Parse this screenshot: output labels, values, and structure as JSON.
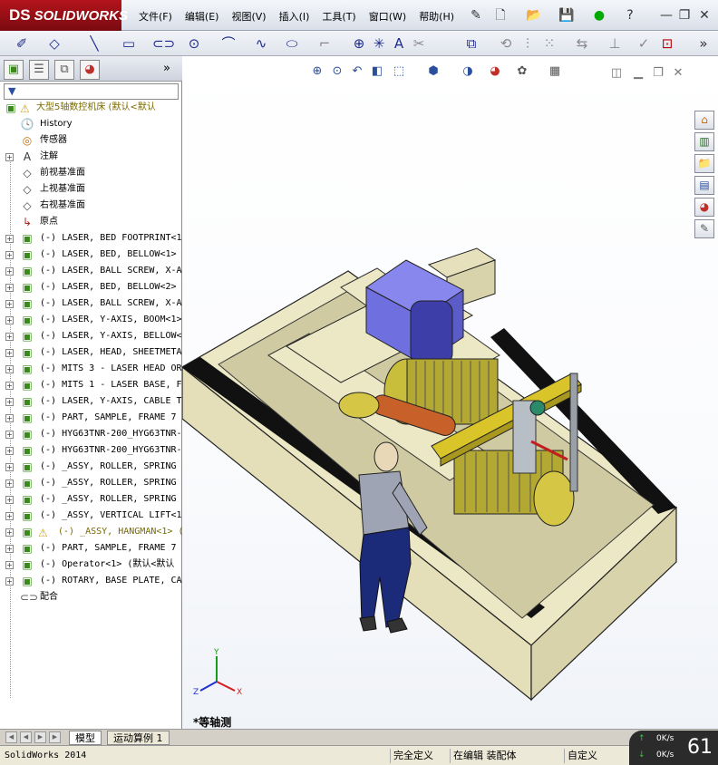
{
  "app": {
    "brand": "SOLIDWORKS",
    "brand_prefix": "DS"
  },
  "menus": [
    "文件(F)",
    "编辑(E)",
    "视图(V)",
    "插入(I)",
    "工具(T)",
    "窗口(W)",
    "帮助(H)"
  ],
  "panel": {
    "root_label": "大型5轴数控机床 (默认<默认",
    "tree_items": [
      {
        "label": "History",
        "icon": "history-icon",
        "expand": false
      },
      {
        "label": "传感器",
        "icon": "sensor-icon",
        "expand": false
      },
      {
        "label": "注解",
        "icon": "annotation-icon",
        "expand": true
      },
      {
        "label": "前视基准面",
        "icon": "plane-icon",
        "expand": false
      },
      {
        "label": "上视基准面",
        "icon": "plane-icon",
        "expand": false
      },
      {
        "label": "右视基准面",
        "icon": "plane-icon",
        "expand": false
      },
      {
        "label": "原点",
        "icon": "origin-icon",
        "expand": false
      },
      {
        "label": "(-) LASER, BED FOOTPRINT<1",
        "icon": "assembly-icon",
        "expand": true
      },
      {
        "label": "(-) LASER, BED, BELLOW<1>",
        "icon": "assembly-icon",
        "expand": true
      },
      {
        "label": "(-) LASER, BALL SCREW, X-A",
        "icon": "assembly-icon",
        "expand": true
      },
      {
        "label": "(-) LASER, BED, BELLOW<2>",
        "icon": "assembly-icon",
        "expand": true
      },
      {
        "label": "(-) LASER, BALL SCREW, X-A",
        "icon": "assembly-icon",
        "expand": true
      },
      {
        "label": "(-) LASER, Y-AXIS, BOOM<1>",
        "icon": "assembly-icon",
        "expand": true
      },
      {
        "label": "(-) LASER, Y-AXIS, BELLOW<",
        "icon": "assembly-icon",
        "expand": true
      },
      {
        "label": "(-) LASER, HEAD, SHEETMETA",
        "icon": "assembly-icon",
        "expand": true
      },
      {
        "label": "(-) MITS 3 - LASER HEAD OR",
        "icon": "assembly-icon",
        "expand": true
      },
      {
        "label": "(-) MITS 1 - LASER BASE, F",
        "icon": "assembly-icon",
        "expand": true
      },
      {
        "label": "(-) LASER, Y-AXIS, CABLE T",
        "icon": "assembly-icon",
        "expand": true
      },
      {
        "label": "(-) PART, SAMPLE, FRAME 7",
        "icon": "assembly-icon",
        "expand": true
      },
      {
        "label": "(-) HYG63TNR-200_HYG63TNR-",
        "icon": "assembly-icon",
        "expand": true
      },
      {
        "label": "(-) HYG63TNR-200_HYG63TNR-",
        "icon": "assembly-icon",
        "expand": true
      },
      {
        "label": "(-) _ASSY, ROLLER, SPRING",
        "icon": "assembly-icon",
        "expand": true
      },
      {
        "label": "(-) _ASSY, ROLLER, SPRING",
        "icon": "assembly-icon",
        "expand": true
      },
      {
        "label": "(-) _ASSY, ROLLER, SPRING",
        "icon": "assembly-icon",
        "expand": true
      },
      {
        "label": "(-) _ASSY, VERTICAL LIFT<1",
        "icon": "assembly-icon",
        "expand": true
      },
      {
        "label": "(-) _ASSY, HANGMAN<1> (",
        "icon": "assembly-icon",
        "expand": true,
        "warning": true
      },
      {
        "label": "(-) PART, SAMPLE, FRAME 7",
        "icon": "assembly-icon",
        "expand": true
      },
      {
        "label": "(-) Operator<1> (默认<默认",
        "icon": "assembly-icon",
        "expand": true
      },
      {
        "label": "(-) ROTARY, BASE PLATE, CA",
        "icon": "assembly-icon",
        "expand": true
      },
      {
        "label": "配合",
        "icon": "mates-icon",
        "expand": false
      }
    ]
  },
  "bottom_tabs": {
    "model": "模型",
    "motion": "运动算例 1"
  },
  "status": {
    "version": "SolidWorks 2014",
    "defined": "完全定义",
    "editing": "在编辑 装配体",
    "custom": "自定义"
  },
  "network": {
    "up": "0K/s",
    "down": "0K/s",
    "percent": "61"
  },
  "viewport": {
    "view_label": "*等轴测",
    "axes": {
      "x": "X",
      "y": "Y",
      "z": "Z"
    }
  },
  "colors": {
    "brand_red": "#b4141c",
    "machine_body": "#ece8c6",
    "head_blue": "#6f6fe0",
    "roller_yellow": "#c9bd3c",
    "boom_yellow": "#d9c52a",
    "operator_blue": "#1c2a7a"
  }
}
